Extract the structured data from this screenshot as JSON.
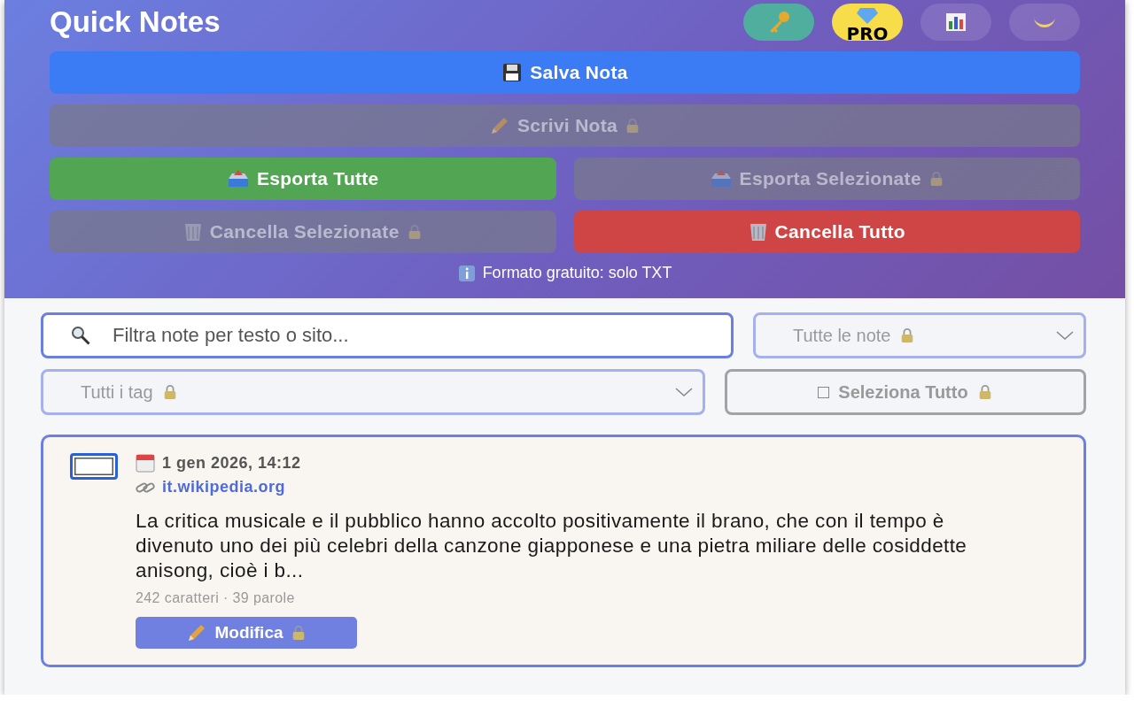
{
  "header": {
    "title": "Quick Notes",
    "icon_buttons": [
      {
        "kind": "key"
      },
      {
        "kind": "pro",
        "label": "PRO"
      },
      {
        "kind": "stats"
      },
      {
        "kind": "theme"
      }
    ]
  },
  "actions": [
    {
      "label": "Salva Nota",
      "kind": "save",
      "disabled": false,
      "locked": false
    },
    {
      "label": "Scrivi Nota",
      "kind": "write",
      "disabled": true,
      "locked": true
    },
    {
      "label": "Esporta Tutte",
      "kind": "export",
      "disabled": false,
      "locked": false
    },
    {
      "label": "Esporta Selezionate",
      "kind": "export",
      "disabled": true,
      "locked": true
    },
    {
      "label": "Cancella Selezionate",
      "kind": "delete",
      "disabled": true,
      "locked": true
    },
    {
      "label": "Cancella Tutto",
      "kind": "delete",
      "disabled": false,
      "locked": false
    }
  ],
  "format_note": "Formato gratuito: solo TXT",
  "filters": {
    "search": {
      "placeholder": "Filtra note per testo o sito..."
    },
    "note_filter": {
      "value": "Tutte le note",
      "locked": true
    },
    "tag_filter": {
      "value": "Tutti i tag",
      "locked": true
    },
    "select_all": {
      "label": "Seleziona Tutto",
      "checked": false,
      "locked": true
    }
  },
  "notes": [
    {
      "selected": false,
      "date": "1 gen 2026, 14:12",
      "site": "it.wikipedia.org",
      "text": "La critica musicale e il pubblico hanno accolto positivamente il brano, che con il tempo è divenuto uno dei più celebri della canzone giapponese e una pietra miliare delle cosiddette anisong, cioè i b...",
      "stats": "242 caratteri · 39 parole",
      "edit_label": "Modifica",
      "edit_locked": true
    }
  ]
}
